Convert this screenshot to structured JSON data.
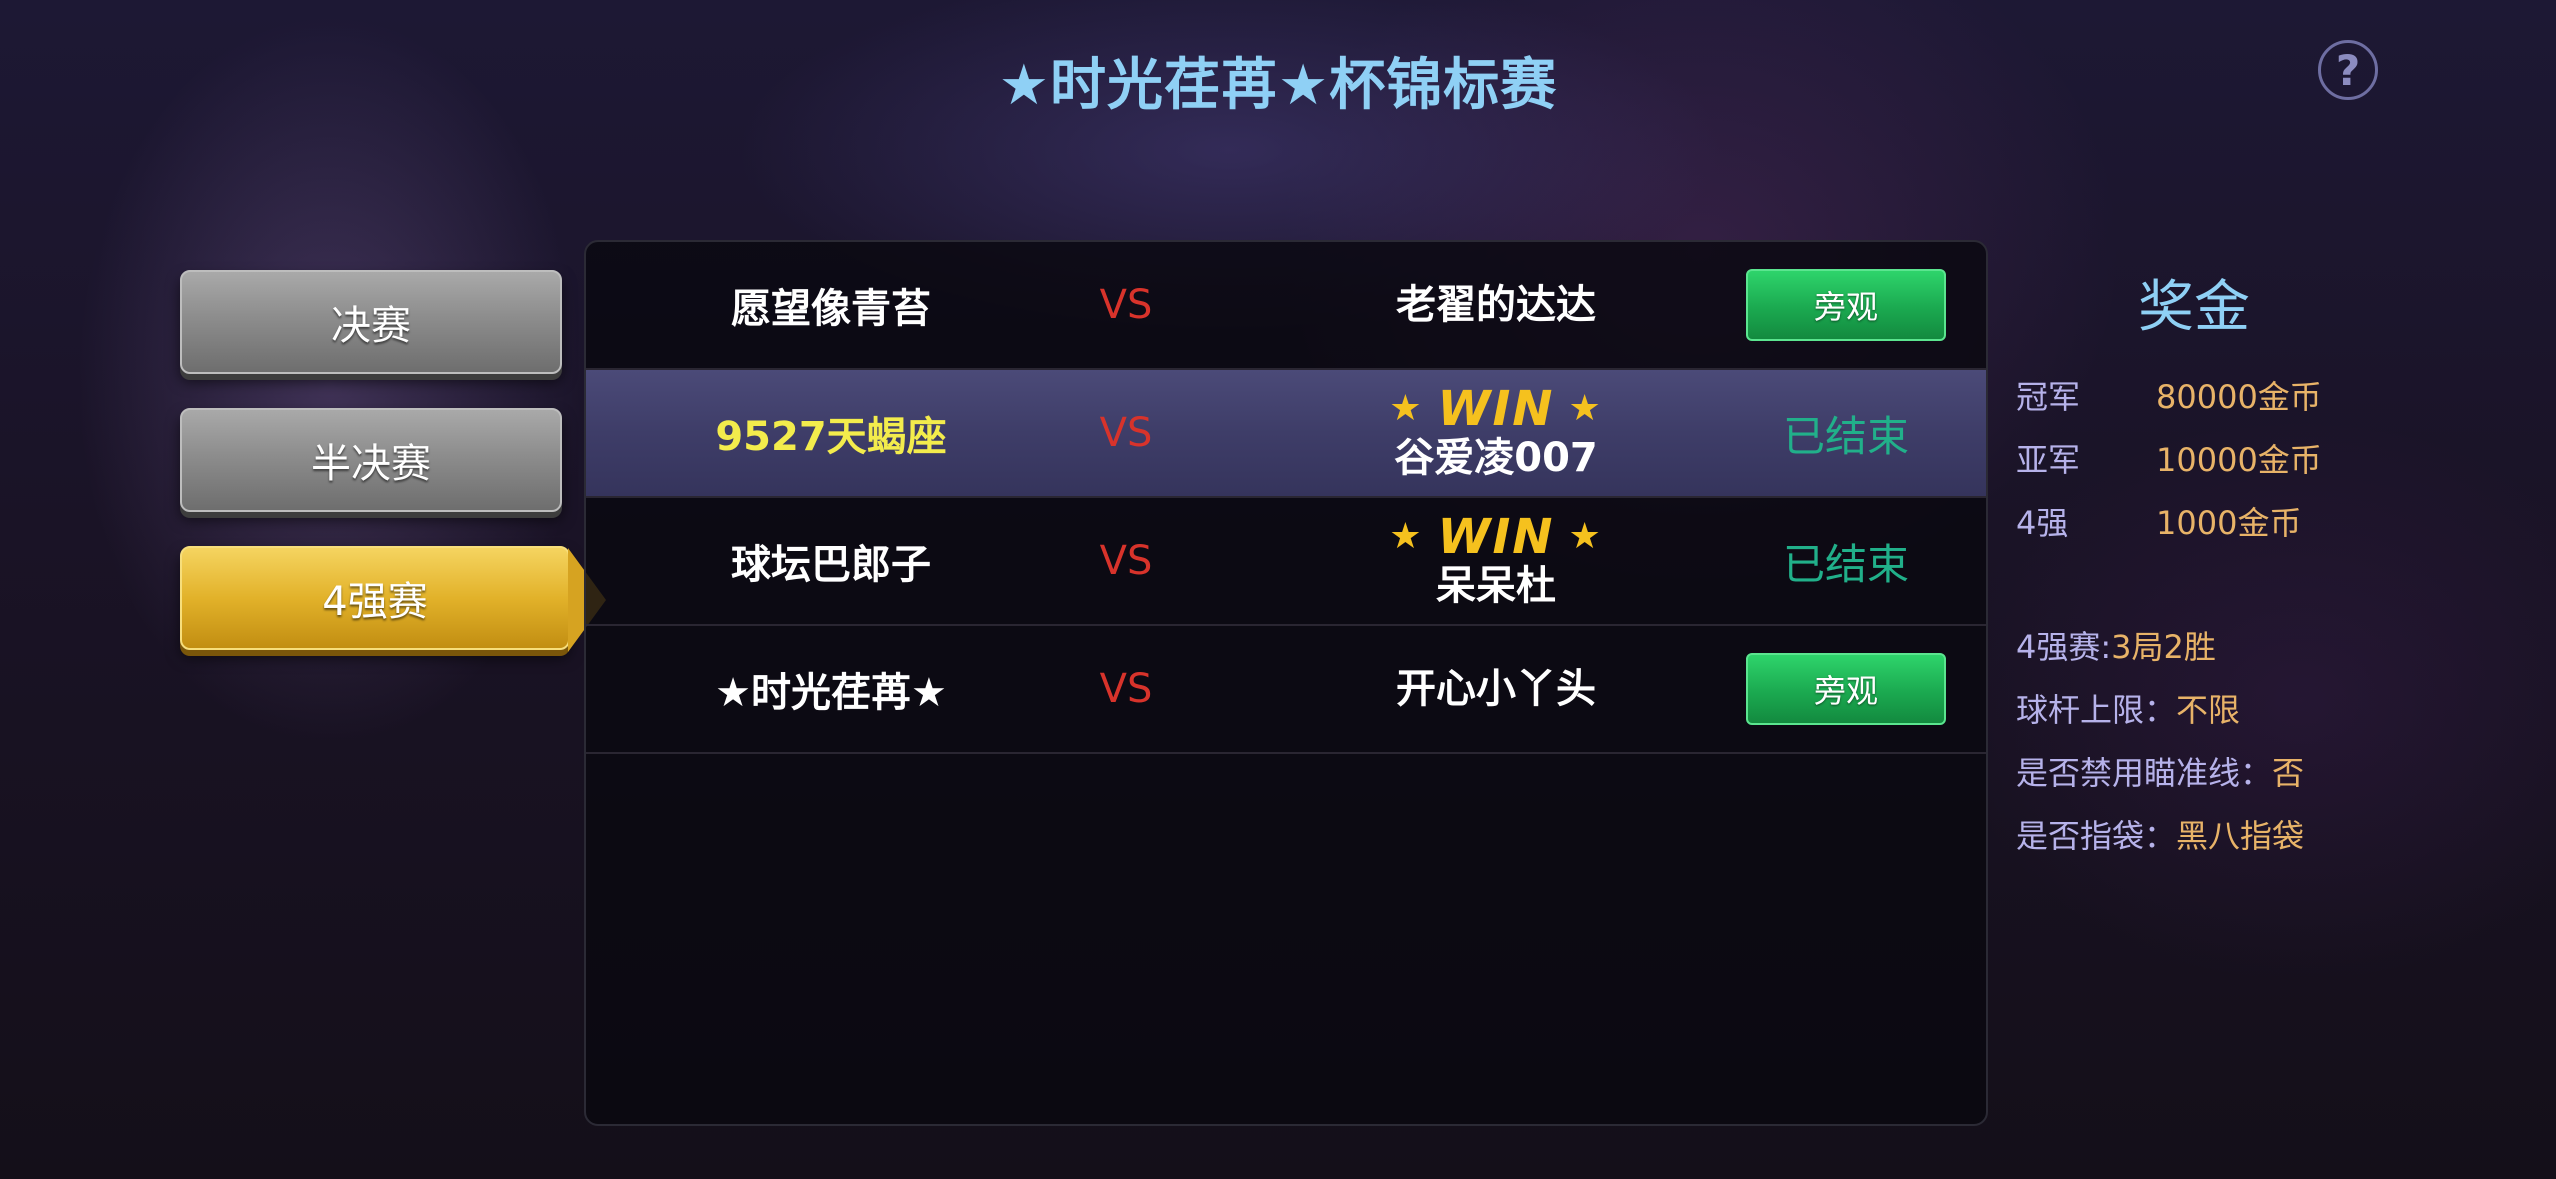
{
  "header": {
    "title": "★时光荏苒★杯锦标赛",
    "help_label": "?"
  },
  "tabs": [
    {
      "label": "决赛",
      "active": false
    },
    {
      "label": "半决赛",
      "active": false
    },
    {
      "label": "4强赛",
      "active": true
    }
  ],
  "matches": [
    {
      "player1": "愿望像青苔",
      "vs": "VS",
      "player2": "老翟的达达",
      "winner_label": "",
      "status": "旁观",
      "status_type": "button"
    },
    {
      "player1": "9527天蝎座",
      "vs": "VS",
      "player2": "谷爱凌007",
      "winner_label": "WIN",
      "status": "已结束",
      "status_type": "text"
    },
    {
      "player1": "球坛巴郎子",
      "vs": "VS",
      "player2": "呆呆杜",
      "winner_label": "WIN",
      "status": "已结束",
      "status_type": "text"
    },
    {
      "player1": "★时光荏苒★",
      "vs": "VS",
      "player2": "开心小丫头",
      "winner_label": "",
      "status": "旁观",
      "status_type": "button"
    }
  ],
  "prizes": {
    "title": "奖金",
    "items": [
      {
        "rank": "冠军",
        "amount": "80000金币"
      },
      {
        "rank": "亚军",
        "amount": "10000金币"
      },
      {
        "rank": "4强",
        "amount": "1000金币"
      }
    ]
  },
  "rules": [
    {
      "label": "4强赛: ",
      "value": "3局2胜"
    },
    {
      "label": "球杆上限：",
      "value": "不限"
    },
    {
      "label": "是否禁用瞄准线：",
      "value": "否"
    },
    {
      "label": "是否指袋：",
      "value": "黑八指袋"
    }
  ],
  "colors": {
    "title": "#8fd0f5",
    "vs": "#d8332b",
    "win": "#f5c11e",
    "ended": "#21b08a",
    "watch_button": "#1ba950",
    "highlight_row": "#3e3d68",
    "highlight_name": "#f3ec4c",
    "prize_value": "#e8b368"
  }
}
